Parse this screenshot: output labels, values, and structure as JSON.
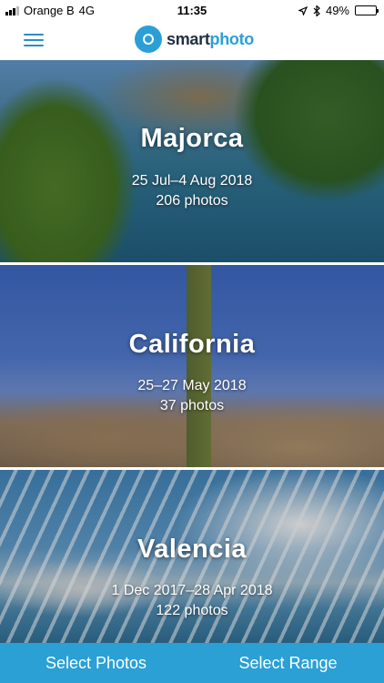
{
  "status_bar": {
    "carrier": "Orange B",
    "network": "4G",
    "time": "11:35",
    "battery": "49%",
    "battery_level": 0.49,
    "icons": [
      "signal-icon",
      "location-arrow-icon",
      "bluetooth-icon",
      "battery-icon"
    ]
  },
  "header": {
    "logo_prefix": "smart",
    "logo_suffix": "photo",
    "menu_icon": "hamburger-menu-icon",
    "brand_color": "#2a9fd6"
  },
  "albums": [
    {
      "title": "Majorca",
      "dates": "25 Jul–4 Aug 2018",
      "count": "206 photos"
    },
    {
      "title": "California",
      "dates": "25–27 May 2018",
      "count": "37 photos"
    },
    {
      "title": "Valencia",
      "dates": "1 Dec 2017–28 Apr 2018",
      "count": "122 photos"
    }
  ],
  "bottom_bar": {
    "select_photos": "Select Photos",
    "select_range": "Select Range",
    "color": "#2aa0d4"
  }
}
